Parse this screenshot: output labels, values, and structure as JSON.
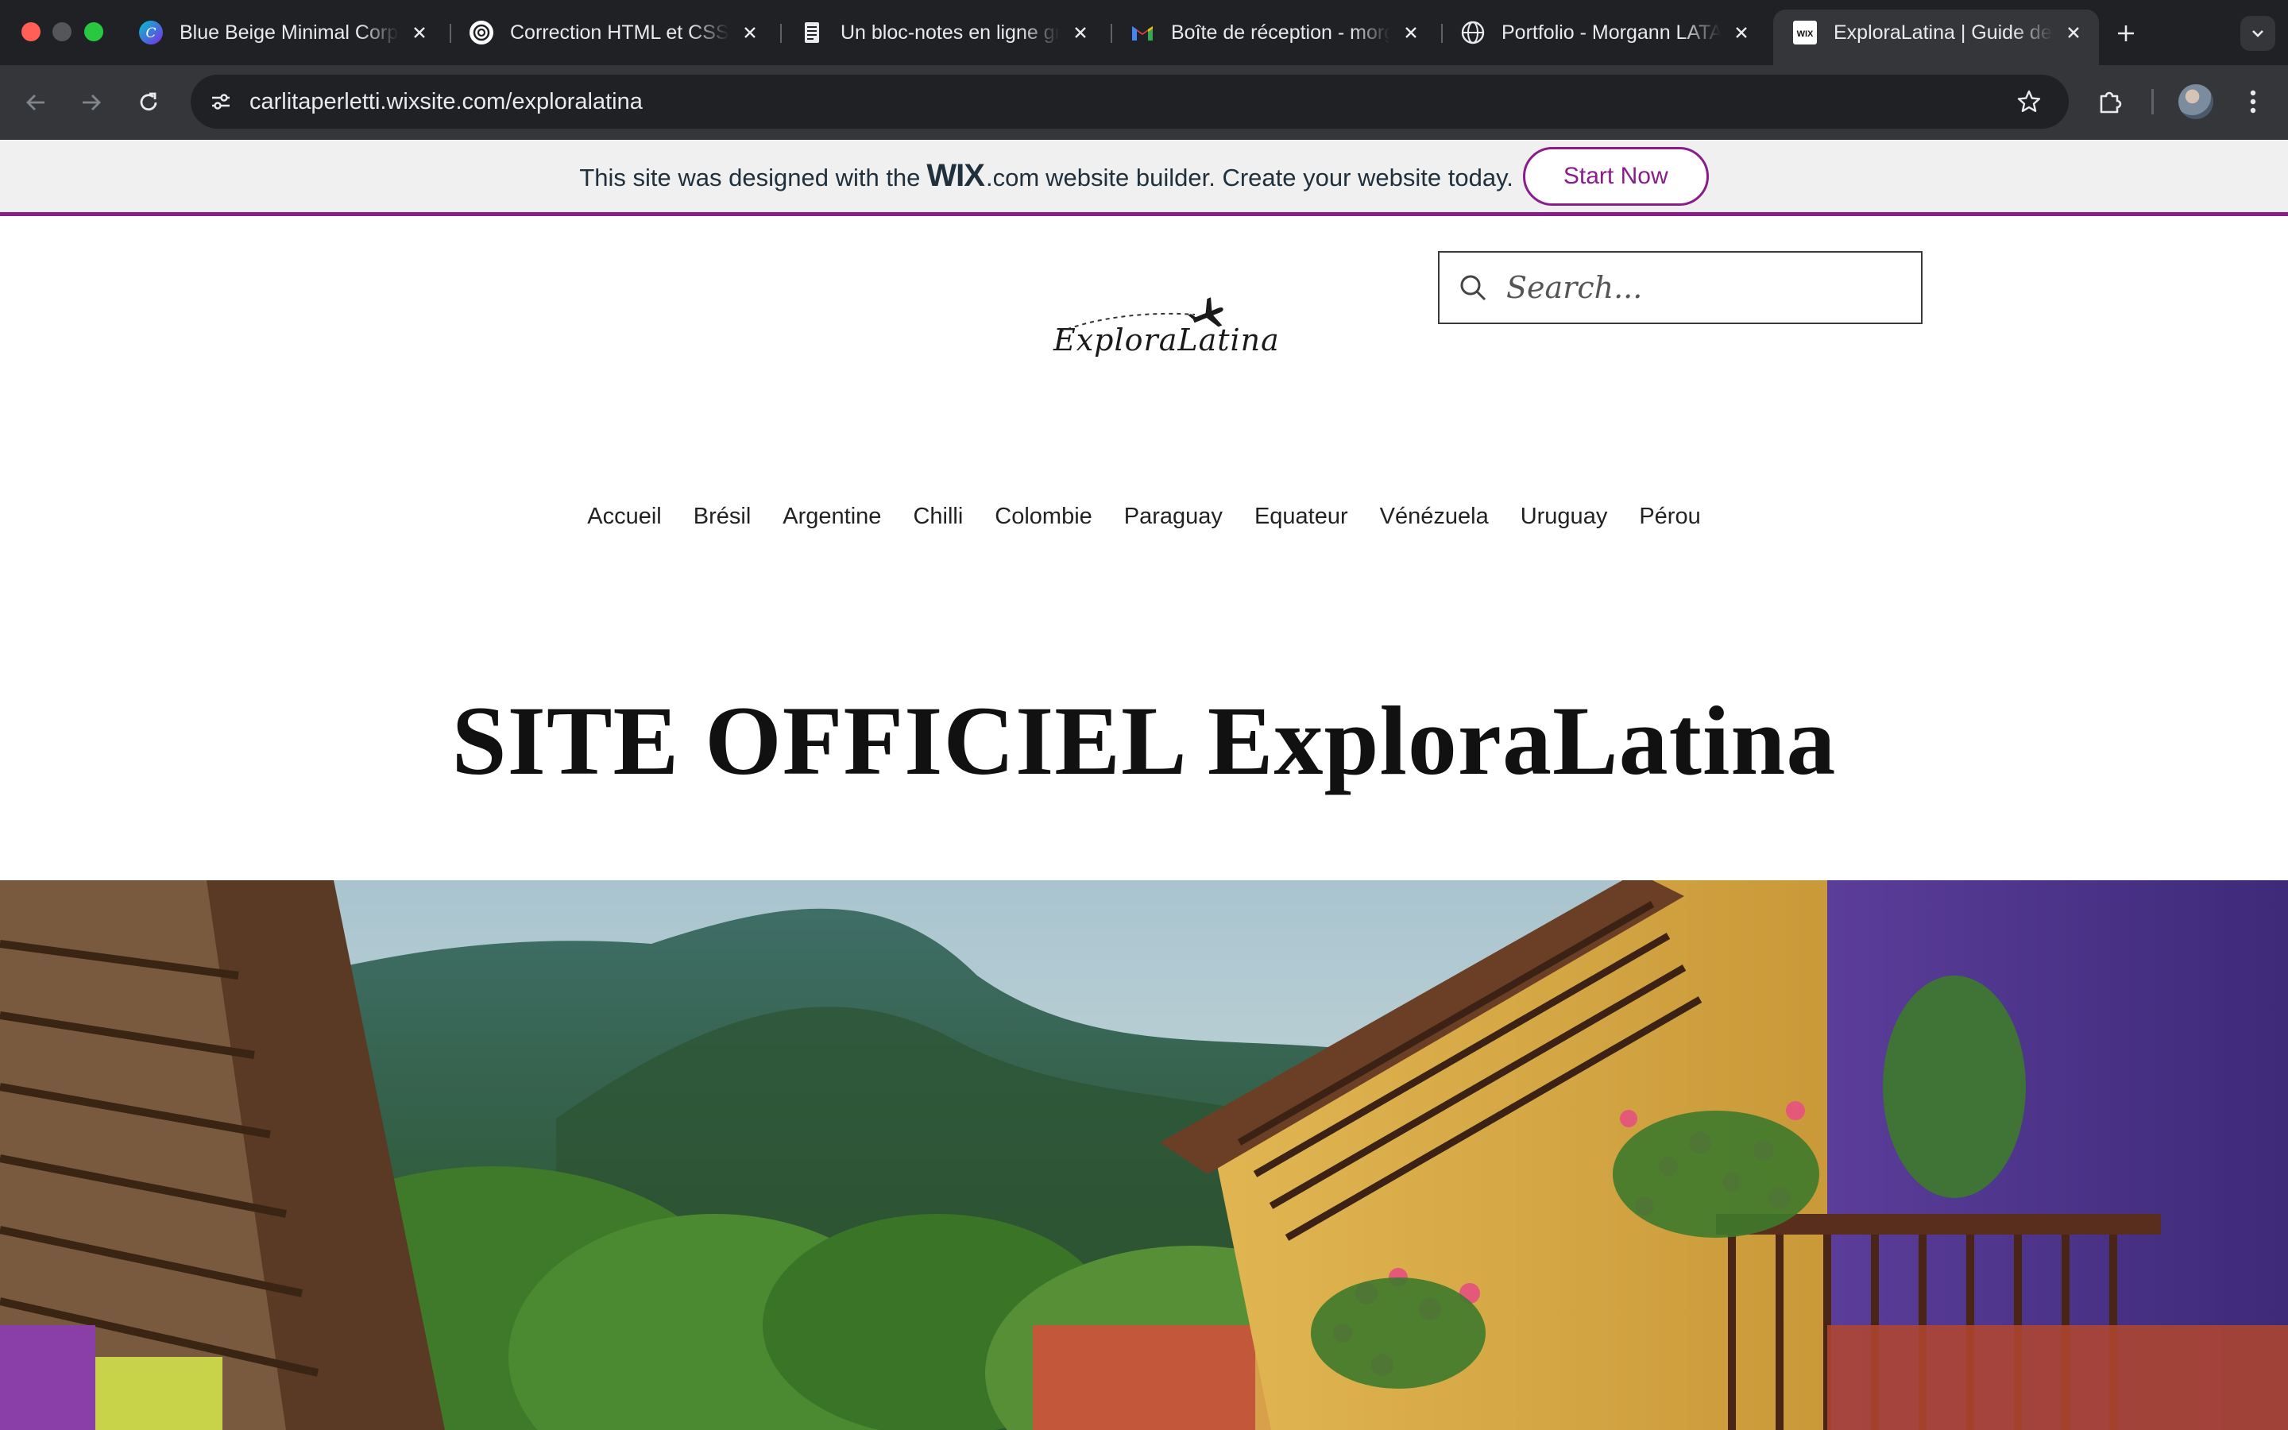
{
  "browser": {
    "tabs": [
      {
        "title": "Blue Beige Minimal Corporate",
        "icon": "canva-icon",
        "active": false
      },
      {
        "title": "Correction HTML et CSS",
        "icon": "openai-icon",
        "active": false
      },
      {
        "title": "Un bloc-notes en ligne gratuit",
        "icon": "notepad-icon",
        "active": false
      },
      {
        "title": "Boîte de réception - morgann",
        "icon": "gmail-icon",
        "active": false
      },
      {
        "title": "Portfolio - Morgann LATAPIE",
        "icon": "globe-icon",
        "active": false
      },
      {
        "title": "ExploraLatina | Guide de voyage",
        "icon": "wix-icon",
        "active": true
      }
    ],
    "url_host": "carlitaperletti.wixsite.com",
    "url_path": "/exploralatina",
    "favicon_wix_text": "WIX"
  },
  "wix_banner": {
    "text_before": "This site was designed with the",
    "logo_word": "WIX",
    "logo_suffix": ".com",
    "text_after": "website builder. Create your website today.",
    "button": "Start Now",
    "accent": "#8b1d8b"
  },
  "site": {
    "logo_text": "ExploraLatina",
    "search_placeholder": "Search...",
    "nav": [
      "Accueil",
      "Brésil",
      "Argentine",
      "Chilli",
      "Colombie",
      "Paraguay",
      "Equateur",
      "Vénézuela",
      "Uruguay",
      "Pérou"
    ],
    "hero_title": "SITE OFFICIEL ExploraLatina"
  }
}
